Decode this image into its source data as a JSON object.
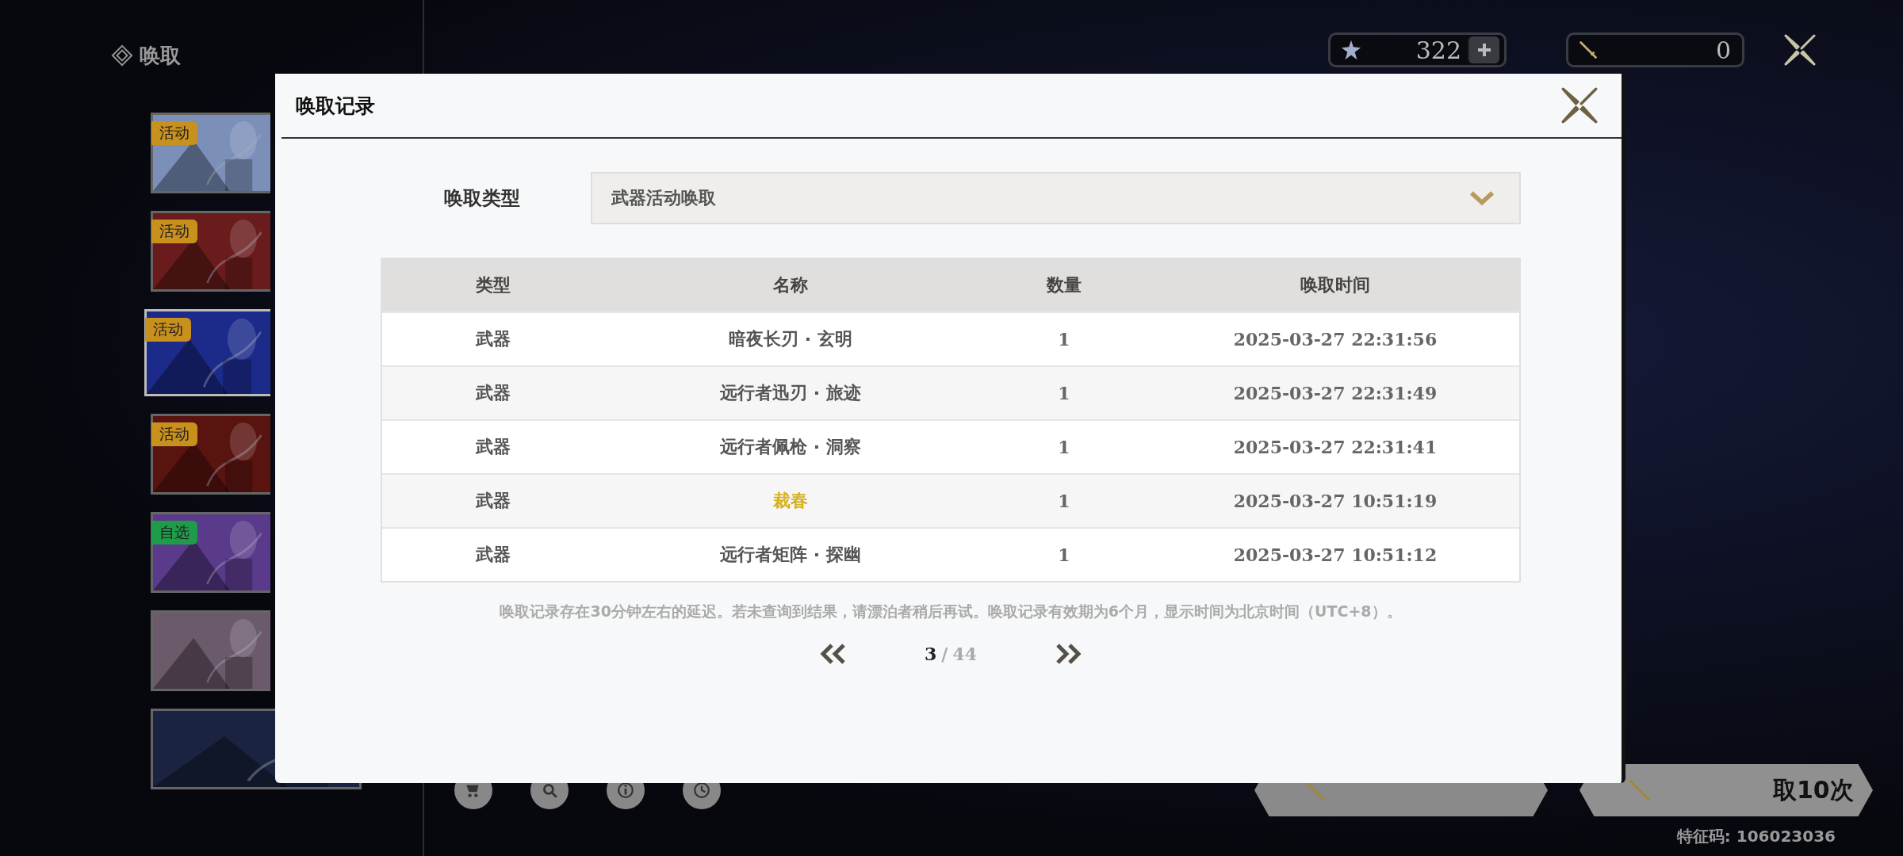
{
  "sidebar": {
    "title": "唤取",
    "banners": [
      {
        "tag": "活动",
        "color": "#c8901c",
        "selected": false
      },
      {
        "tag": "活动",
        "color": "#c8901c",
        "selected": false
      },
      {
        "tag": "活动",
        "color": "#c8901c",
        "selected": true
      },
      {
        "tag": "活动",
        "color": "#c8901c",
        "selected": false
      },
      {
        "tag": "自选",
        "color": "#1f9c4a",
        "selected": false
      },
      {
        "selected": false
      },
      {
        "selected": false
      }
    ]
  },
  "currencies": [
    {
      "kind": "star",
      "amount": "322"
    },
    {
      "kind": "sword",
      "amount": "0"
    }
  ],
  "toolbar": [
    {
      "kind": "shop"
    },
    {
      "kind": "search"
    },
    {
      "kind": "info"
    },
    {
      "kind": "history"
    }
  ],
  "draw_buttons": [
    {
      "kind": "single"
    },
    {
      "kind": "multi",
      "label": "取10次"
    }
  ],
  "feature_code": "特征码: 106023036",
  "modal": {
    "title": "唤取记录",
    "filter": {
      "label": "唤取类型",
      "value": "武器活动唤取"
    },
    "table": {
      "columns": [
        "类型",
        "名称",
        "数量",
        "唤取时间"
      ],
      "rows": [
        {
          "type": "武器",
          "name": "暗夜长刃 · 玄明",
          "count": "1",
          "time": "2025-03-27 22:31:56",
          "rare": false
        },
        {
          "type": "武器",
          "name": "远行者迅刃 · 旅迹",
          "count": "1",
          "time": "2025-03-27 22:31:49",
          "rare": false
        },
        {
          "type": "武器",
          "name": "远行者佩枪 · 洞察",
          "count": "1",
          "time": "2025-03-27 22:31:41",
          "rare": false
        },
        {
          "type": "武器",
          "name": "裁春",
          "count": "1",
          "time": "2025-03-27 10:51:19",
          "rare": true
        },
        {
          "type": "武器",
          "name": "远行者矩阵 · 探幽",
          "count": "1",
          "time": "2025-03-27 10:51:12",
          "rare": false
        }
      ]
    },
    "note": "唤取记录存在30分钟左右的延迟。若未查询到结果，请漂泊者稍后再试。唤取记录有效期为6个月，显示时间为北京时间（UTC+8）。",
    "page": {
      "current": "3",
      "separator": "/",
      "total": "44"
    }
  }
}
